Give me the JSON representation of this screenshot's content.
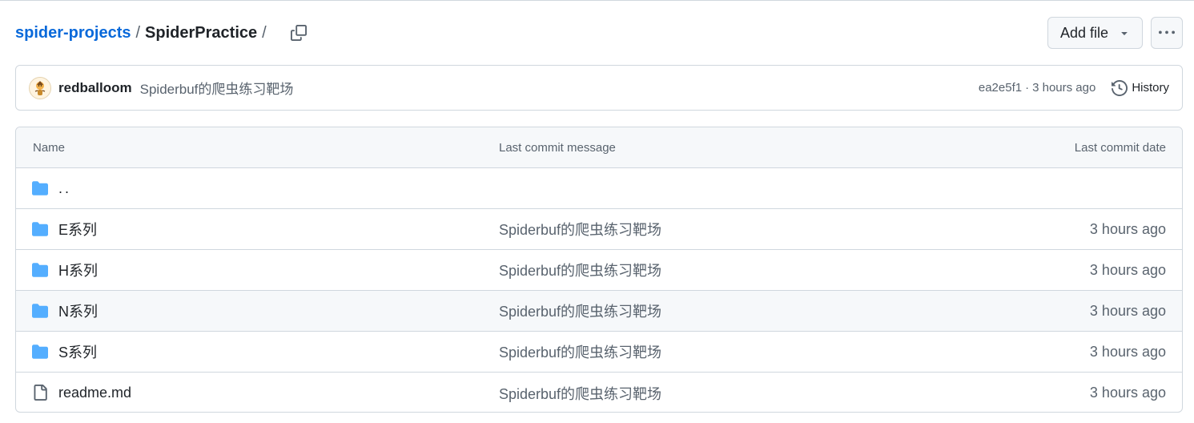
{
  "breadcrumb": {
    "repo": "spider-projects",
    "sep1": "/",
    "folder": "SpiderPractice",
    "sep2": "/"
  },
  "actions": {
    "add_file_label": "Add file"
  },
  "commit": {
    "author": "redballoom",
    "message": "Spiderbuf的爬虫练习靶场",
    "hash": "ea2e5f1",
    "dot": "·",
    "time": "3 hours ago",
    "history_label": "History"
  },
  "table": {
    "headers": {
      "name": "Name",
      "message": "Last commit message",
      "date": "Last commit date"
    },
    "parent": "..",
    "rows": [
      {
        "name": "E系列",
        "message": "Spiderbuf的爬虫练习靶场",
        "date": "3 hours ago",
        "type": "folder"
      },
      {
        "name": "H系列",
        "message": "Spiderbuf的爬虫练习靶场",
        "date": "3 hours ago",
        "type": "folder"
      },
      {
        "name": "N系列",
        "message": "Spiderbuf的爬虫练习靶场",
        "date": "3 hours ago",
        "type": "folder"
      },
      {
        "name": "S系列",
        "message": "Spiderbuf的爬虫练习靶场",
        "date": "3 hours ago",
        "type": "folder"
      },
      {
        "name": "readme.md",
        "message": "Spiderbuf的爬虫练习靶场",
        "date": "3 hours ago",
        "type": "file"
      }
    ]
  },
  "colors": {
    "link": "#0969da",
    "folder": "#54aeff",
    "muted": "#59636e",
    "border": "#d0d7de"
  },
  "icons": {
    "copy": "copy-icon",
    "caret": "triangle-down-icon",
    "more": "kebab-horizontal-icon",
    "history": "history-icon",
    "folder": "folder-icon",
    "file": "file-icon"
  }
}
